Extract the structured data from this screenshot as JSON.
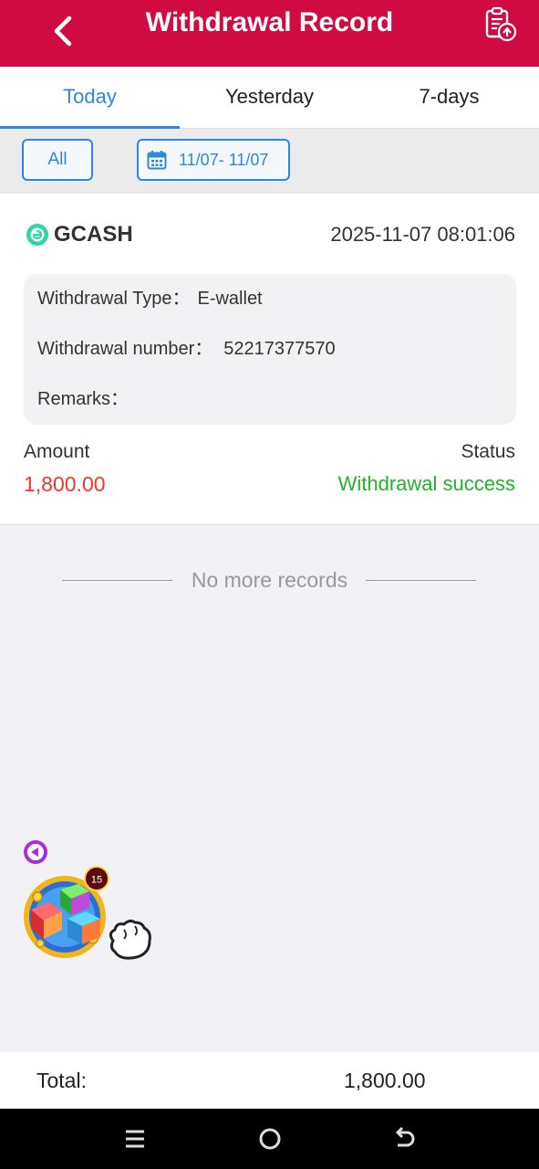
{
  "header": {
    "title": "Withdrawal Record",
    "back_icon": "chevron-left-icon",
    "export_icon": "clipboard-upload-icon",
    "background": "#d00b42"
  },
  "tabs": [
    {
      "label": "Today",
      "active": true
    },
    {
      "label": "Yesterday",
      "active": false
    },
    {
      "label": "7-days",
      "active": false
    }
  ],
  "filters": {
    "all_label": "All",
    "date_range": "11/07- 11/07",
    "calendar_icon": "calendar-icon"
  },
  "record": {
    "method": "GCASH",
    "method_icon": "gcash-icon",
    "datetime": "2025-11-07 08:01:06",
    "details": [
      {
        "label": "Withdrawal Type：",
        "value": "E-wallet"
      },
      {
        "label": "Withdrawal number：",
        "value": "52217377570"
      },
      {
        "label": "Remarks：",
        "value": ""
      }
    ],
    "amount_label": "Amount",
    "amount": "1,800.00",
    "status_label": "Status",
    "status": "Withdrawal success"
  },
  "no_more_text": "No more records",
  "floating_widget": {
    "badge_count": "15",
    "icon": "dice-game-icon"
  },
  "footer": {
    "total_label": "Total:",
    "total_value": "1,800.00"
  },
  "colors": {
    "accent_blue": "#2e86de",
    "amount_red": "#e53b2c",
    "success_green": "#1fb52b"
  }
}
